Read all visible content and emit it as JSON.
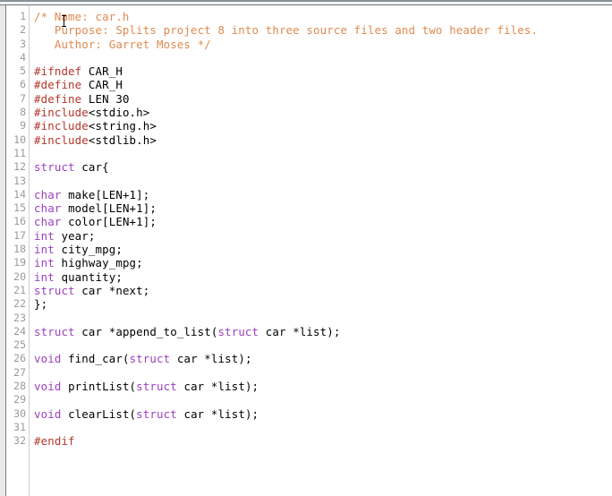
{
  "editor": {
    "file_name": "car.h",
    "language": "c",
    "caret": {
      "line": 1,
      "column": 1
    },
    "total_lines": 32,
    "colors": {
      "background": "#ffffff",
      "comment": "#e08a50",
      "preprocessor": "#b3362c",
      "keyword": "#9b3fbf",
      "plain_text": "#000000",
      "line_number": "#9a9a9a",
      "gutter_background": "#ffffff",
      "marker_strip": "#e9e9e9",
      "top_band": "#f2f2f0",
      "top_band_border": "#6e7580"
    },
    "line_numbers": [
      "1",
      "2",
      "3",
      "4",
      "5",
      "6",
      "7",
      "8",
      "9",
      "10",
      "11",
      "12",
      "13",
      "14",
      "15",
      "16",
      "17",
      "18",
      "19",
      "20",
      "21",
      "22",
      "23",
      "24",
      "25",
      "26",
      "27",
      "28",
      "29",
      "30",
      "31",
      "32"
    ],
    "lines": [
      {
        "n": 1,
        "text": "/* Name: car.h",
        "tokens": [
          {
            "t": "/* Name: car.h",
            "k": "comment"
          }
        ]
      },
      {
        "n": 2,
        "text": "   Purpose: Splits project 8 into three source files and two header files.",
        "tokens": [
          {
            "t": "   Purpose: Splits project 8 into three source files and two header files.",
            "k": "comment"
          }
        ]
      },
      {
        "n": 3,
        "text": "   Author: Garret Moses */",
        "tokens": [
          {
            "t": "   Author: Garret Moses */",
            "k": "comment"
          }
        ]
      },
      {
        "n": 4,
        "text": "",
        "tokens": []
      },
      {
        "n": 5,
        "text": "#ifndef CAR_H",
        "tokens": [
          {
            "t": "#ifndef",
            "k": "preproc"
          },
          {
            "t": " CAR_H",
            "k": "plain"
          }
        ]
      },
      {
        "n": 6,
        "text": "#define CAR_H",
        "tokens": [
          {
            "t": "#define",
            "k": "preproc"
          },
          {
            "t": " CAR_H",
            "k": "plain"
          }
        ]
      },
      {
        "n": 7,
        "text": "#define LEN 30",
        "tokens": [
          {
            "t": "#define",
            "k": "preproc"
          },
          {
            "t": " LEN 30",
            "k": "plain"
          }
        ]
      },
      {
        "n": 8,
        "text": "#include<stdio.h>",
        "tokens": [
          {
            "t": "#include",
            "k": "preproc"
          },
          {
            "t": "<stdio.h>",
            "k": "plain"
          }
        ]
      },
      {
        "n": 9,
        "text": "#include<string.h>",
        "tokens": [
          {
            "t": "#include",
            "k": "preproc"
          },
          {
            "t": "<string.h>",
            "k": "plain"
          }
        ]
      },
      {
        "n": 10,
        "text": "#include<stdlib.h>",
        "tokens": [
          {
            "t": "#include",
            "k": "preproc"
          },
          {
            "t": "<stdlib.h>",
            "k": "plain"
          }
        ]
      },
      {
        "n": 11,
        "text": "",
        "tokens": []
      },
      {
        "n": 12,
        "text": "struct car{",
        "tokens": [
          {
            "t": "struct",
            "k": "keyword"
          },
          {
            "t": " car{",
            "k": "plain"
          }
        ]
      },
      {
        "n": 13,
        "text": "",
        "tokens": []
      },
      {
        "n": 14,
        "text": "char make[LEN+1];",
        "tokens": [
          {
            "t": "char",
            "k": "keyword"
          },
          {
            "t": " make[LEN+1];",
            "k": "plain"
          }
        ]
      },
      {
        "n": 15,
        "text": "char model[LEN+1];",
        "tokens": [
          {
            "t": "char",
            "k": "keyword"
          },
          {
            "t": " model[LEN+1];",
            "k": "plain"
          }
        ]
      },
      {
        "n": 16,
        "text": "char color[LEN+1];",
        "tokens": [
          {
            "t": "char",
            "k": "keyword"
          },
          {
            "t": " color[LEN+1];",
            "k": "plain"
          }
        ]
      },
      {
        "n": 17,
        "text": "int year;",
        "tokens": [
          {
            "t": "int",
            "k": "keyword"
          },
          {
            "t": " year;",
            "k": "plain"
          }
        ]
      },
      {
        "n": 18,
        "text": "int city_mpg;",
        "tokens": [
          {
            "t": "int",
            "k": "keyword"
          },
          {
            "t": " city_mpg;",
            "k": "plain"
          }
        ]
      },
      {
        "n": 19,
        "text": "int highway_mpg;",
        "tokens": [
          {
            "t": "int",
            "k": "keyword"
          },
          {
            "t": " highway_mpg;",
            "k": "plain"
          }
        ]
      },
      {
        "n": 20,
        "text": "int quantity;",
        "tokens": [
          {
            "t": "int",
            "k": "keyword"
          },
          {
            "t": " quantity;",
            "k": "plain"
          }
        ]
      },
      {
        "n": 21,
        "text": "struct car *next;",
        "tokens": [
          {
            "t": "struct",
            "k": "keyword"
          },
          {
            "t": " car *next;",
            "k": "plain"
          }
        ]
      },
      {
        "n": 22,
        "text": "};",
        "tokens": [
          {
            "t": "};",
            "k": "plain"
          }
        ]
      },
      {
        "n": 23,
        "text": "",
        "tokens": []
      },
      {
        "n": 24,
        "text": "struct car *append_to_list(struct car *list);",
        "tokens": [
          {
            "t": "struct",
            "k": "keyword"
          },
          {
            "t": " car *append_to_list(",
            "k": "plain"
          },
          {
            "t": "struct",
            "k": "keyword"
          },
          {
            "t": " car *list);",
            "k": "plain"
          }
        ]
      },
      {
        "n": 25,
        "text": "",
        "tokens": []
      },
      {
        "n": 26,
        "text": "void find_car(struct car *list);",
        "tokens": [
          {
            "t": "void",
            "k": "keyword"
          },
          {
            "t": " find_car(",
            "k": "plain"
          },
          {
            "t": "struct",
            "k": "keyword"
          },
          {
            "t": " car *list);",
            "k": "plain"
          }
        ]
      },
      {
        "n": 27,
        "text": "",
        "tokens": []
      },
      {
        "n": 28,
        "text": "void printList(struct car *list);",
        "tokens": [
          {
            "t": "void",
            "k": "keyword"
          },
          {
            "t": " printList(",
            "k": "plain"
          },
          {
            "t": "struct",
            "k": "keyword"
          },
          {
            "t": " car *list);",
            "k": "plain"
          }
        ]
      },
      {
        "n": 29,
        "text": "",
        "tokens": []
      },
      {
        "n": 30,
        "text": "void clearList(struct car *list);",
        "tokens": [
          {
            "t": "void",
            "k": "keyword"
          },
          {
            "t": " clearList(",
            "k": "plain"
          },
          {
            "t": "struct",
            "k": "keyword"
          },
          {
            "t": " car *list);",
            "k": "plain"
          }
        ]
      },
      {
        "n": 31,
        "text": "",
        "tokens": []
      },
      {
        "n": 32,
        "text": "#endif",
        "tokens": [
          {
            "t": "#endif",
            "k": "preproc"
          }
        ]
      }
    ]
  }
}
